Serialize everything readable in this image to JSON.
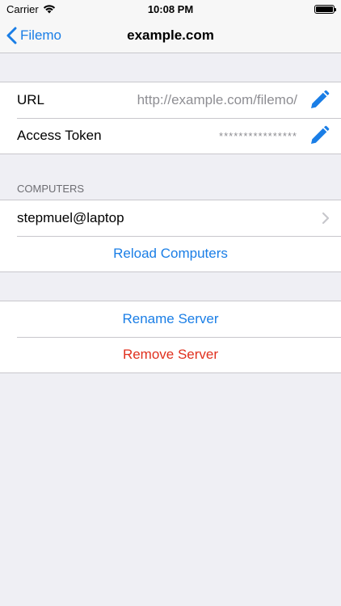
{
  "status_bar": {
    "carrier": "Carrier",
    "time": "10:08 PM"
  },
  "nav": {
    "back_label": "Filemo",
    "title": "example.com"
  },
  "server": {
    "url_label": "URL",
    "url_value": "http://example.com/filemo/",
    "token_label": "Access Token",
    "token_value": "****************"
  },
  "computers": {
    "header": "COMPUTERS",
    "items": [
      {
        "label": "stepmuel@laptop"
      }
    ],
    "reload_label": "Reload Computers"
  },
  "actions": {
    "rename_label": "Rename Server",
    "remove_label": "Remove Server"
  },
  "colors": {
    "accent": "#1a7ee6",
    "destructive": "#e0301e",
    "background": "#efeff4"
  }
}
